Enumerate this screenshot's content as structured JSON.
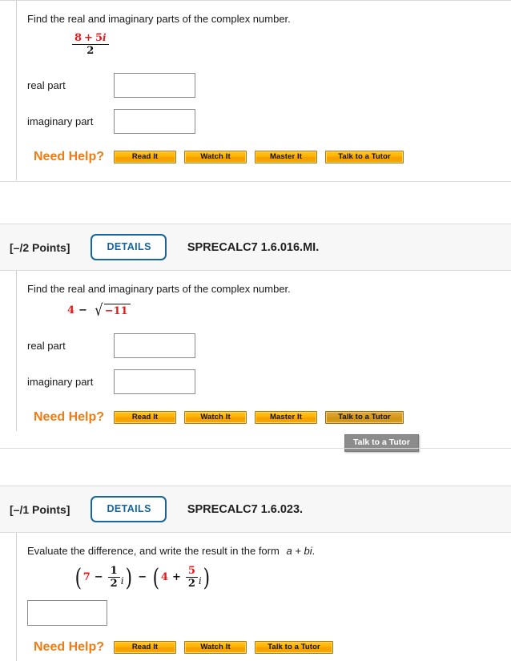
{
  "questions": [
    {
      "id": "q1",
      "prompt": "Find the real and imaginary parts of the complex number.",
      "expression": {
        "numerator_a": "8",
        "operator": "+",
        "numerator_b": "5",
        "imaginary_unit": "i",
        "denominator": "2"
      },
      "answers": [
        {
          "label": "real part",
          "value": "",
          "placeholder": ""
        },
        {
          "label": "imaginary part",
          "value": "",
          "placeholder": ""
        }
      ],
      "need_help_label": "Need Help?",
      "help_buttons": [
        {
          "label": "Read It",
          "hovered": false
        },
        {
          "label": "Watch It",
          "hovered": false
        },
        {
          "label": "Master It",
          "hovered": false
        },
        {
          "label": "Talk to a Tutor",
          "hovered": false
        }
      ]
    },
    {
      "id": "q2",
      "index_marker": ".",
      "points": "[–/2 Points]",
      "details_label": "DETAILS",
      "code": "SPRECALC7 1.6.016.MI.",
      "prompt": "Find the real and imaginary parts of the complex number.",
      "expression": {
        "term": "4",
        "operator": "−",
        "radicand": "−11"
      },
      "answers": [
        {
          "label": "real part",
          "value": "",
          "placeholder": ""
        },
        {
          "label": "imaginary part",
          "value": "",
          "placeholder": ""
        }
      ],
      "need_help_label": "Need Help?",
      "help_buttons": [
        {
          "label": "Read It",
          "hovered": false
        },
        {
          "label": "Watch It",
          "hovered": false
        },
        {
          "label": "Master It",
          "hovered": false
        },
        {
          "label": "Talk to a Tutor",
          "hovered": true
        }
      ],
      "tooltip": "Talk to a Tutor"
    },
    {
      "id": "q3",
      "index_marker": ".",
      "points": "[–/1 Points]",
      "details_label": "DETAILS",
      "code": "SPRECALC7 1.6.023.",
      "prompt_part1": "Evaluate the difference, and write the result in the form",
      "prompt_form": "a + bi",
      "prompt_end": ".",
      "expression": {
        "group1": {
          "term": "7",
          "operator": "−",
          "frac_num": "1",
          "frac_den": "2",
          "imaginary_unit": "i"
        },
        "middle_operator": "−",
        "group2": {
          "term": "4",
          "operator": "+",
          "frac_num": "5",
          "frac_den": "2",
          "imaginary_unit": "i"
        }
      },
      "answers": [
        {
          "label": "",
          "value": "",
          "placeholder": ""
        }
      ],
      "need_help_label": "Need Help?",
      "help_buttons": [
        {
          "label": "Read It",
          "hovered": false
        },
        {
          "label": "Watch It",
          "hovered": false
        },
        {
          "label": "Talk to a Tutor",
          "hovered": false
        }
      ]
    }
  ],
  "colors": {
    "math_red": "#e8191b",
    "help_orange": "#f07b10",
    "details_blue": "#15659e",
    "header_band": "#f7f7f7"
  }
}
